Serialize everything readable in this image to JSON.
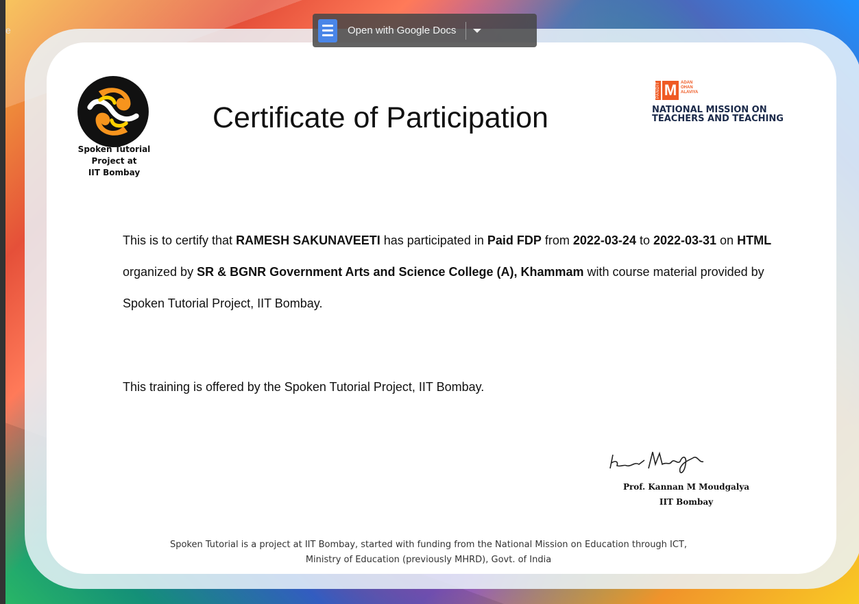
{
  "viewer": {
    "stray_char": "e",
    "open_with_label": "Open with Google Docs"
  },
  "certificate": {
    "title": "Certificate of Participation",
    "left_logo_lines": [
      "Spoken Tutorial",
      "Project at",
      "IIT Bombay"
    ],
    "right_logo": {
      "pandit": "PANDIT",
      "m_letter": "M",
      "words": [
        "ADAN",
        "OHAN",
        "ALAVIYA"
      ],
      "mission_lines": [
        "NATIONAL MISSION ON",
        "TEACHERS AND TEACHING"
      ]
    },
    "body": {
      "t1": "This is to certify that ",
      "name": "RAMESH SAKUNAVEETI",
      "t2": " has participated in ",
      "program": "Paid FDP",
      "t3": " from ",
      "start_date": "2022-03-24",
      "t4": " to ",
      "end_date": "2022-03-31",
      "t5": " on ",
      "course": "HTML",
      "t6": " organized by ",
      "college": "SR & BGNR Government Arts and Science College (A), Khammam",
      "t7": " with course material provided by Spoken Tutorial Project, IIT Bombay."
    },
    "offered_by": "This training is offered by the Spoken Tutorial Project, IIT Bombay.",
    "signatory": {
      "name": "Prof. Kannan M Moudgalya",
      "affiliation": "IIT Bombay"
    },
    "footer": {
      "line1": "Spoken Tutorial is a project at IIT Bombay, started with funding from the National Mission on Education through ICT,",
      "line2": "Ministry of Education (previously MHRD), Govt. of India"
    }
  }
}
